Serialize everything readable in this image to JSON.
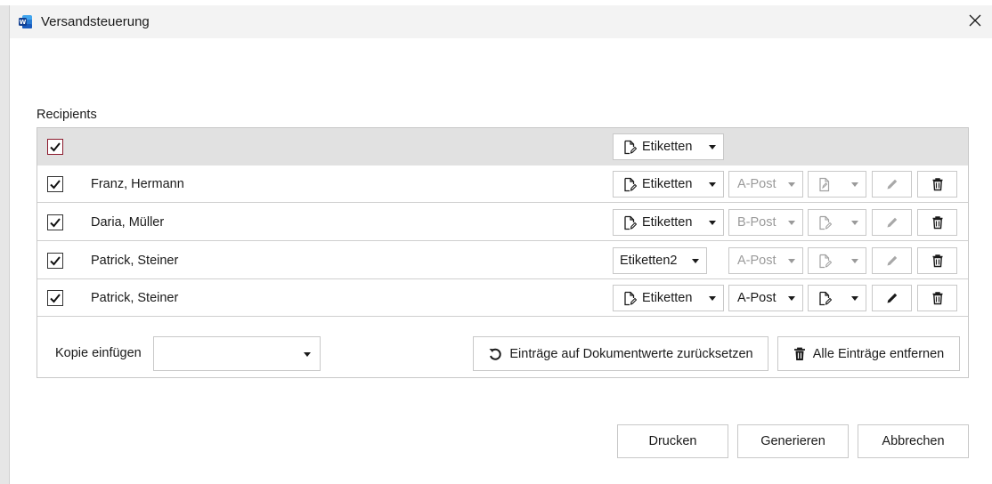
{
  "window": {
    "title": "Versandsteuerung",
    "app_icon": "word-icon",
    "close_glyph": "×"
  },
  "recipients": {
    "label": "Recipients",
    "header": {
      "checked": true,
      "type_label": "Etiketten",
      "type_icon": "document-edit-icon"
    },
    "rows": [
      {
        "checked": true,
        "name": "Franz, Hermann",
        "type_label": "Etiketten",
        "type_has_icon": true,
        "post": "A-Post",
        "post_enabled": false,
        "doc_enabled": false,
        "edit_enabled": false
      },
      {
        "checked": true,
        "name": "Daria, Müller",
        "type_label": "Etiketten",
        "type_has_icon": true,
        "post": "B-Post",
        "post_enabled": false,
        "doc_enabled": false,
        "edit_enabled": false
      },
      {
        "checked": true,
        "name": "Patrick, Steiner",
        "type_label": "Etiketten2",
        "type_has_icon": false,
        "post": "A-Post",
        "post_enabled": false,
        "doc_enabled": false,
        "edit_enabled": false
      },
      {
        "checked": true,
        "name": "Patrick, Steiner",
        "type_label": "Etiketten",
        "type_has_icon": true,
        "post": "A-Post",
        "post_enabled": true,
        "doc_enabled": true,
        "edit_enabled": true
      }
    ]
  },
  "footer": {
    "copy_label": "Kopie einfügen",
    "copy_value": "",
    "reset_label": "Einträge auf Dokumentwerte zurücksetzen",
    "remove_all_label": "Alle Einträge entfernen"
  },
  "actions": {
    "print": "Drucken",
    "generate": "Generieren",
    "cancel": "Abbrechen"
  },
  "colors": {
    "accent_checkbox_border": "#8b1a2c",
    "header_row_bg": "#e1e1e1",
    "disabled_text": "#9a9a9a"
  }
}
